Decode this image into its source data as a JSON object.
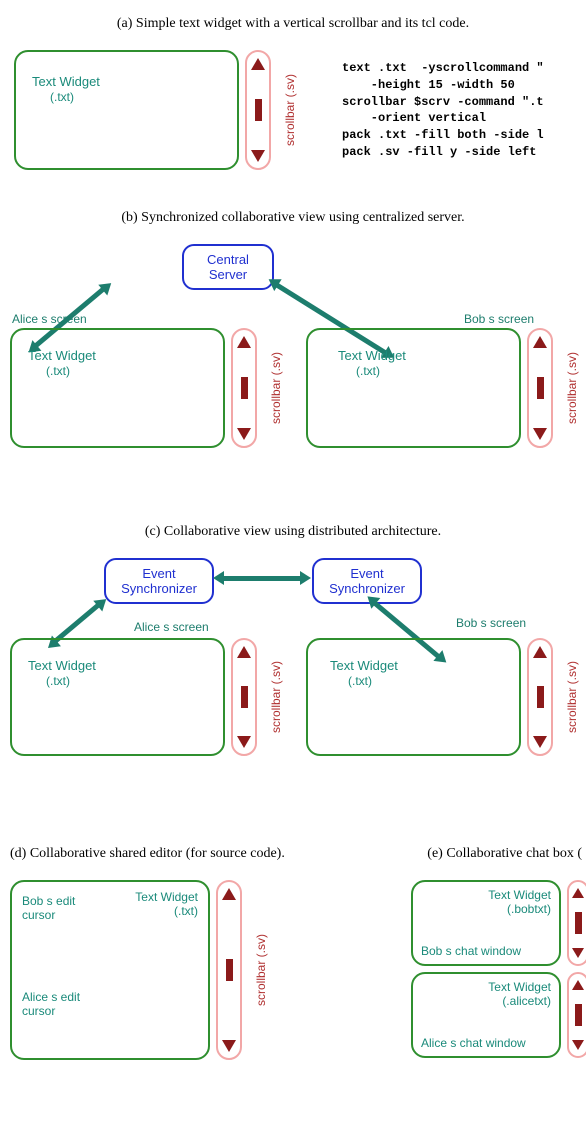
{
  "a": {
    "caption": "(a) Simple text widget with a vertical scrollbar and its tcl code.",
    "widget_label": "Text Widget",
    "widget_sub": "(.txt)",
    "scrollbar_label": "scrollbar (.sv)",
    "code": "text .txt  -yscrollcommand \"\n    -height 15 -width 50\nscrollbar $scrv -command \".t\n    -orient vertical\npack .txt -fill both -side l\npack .sv -fill y -side left"
  },
  "b": {
    "caption": "(b) Synchronized collaborative view using centralized server.",
    "server": "Central\nServer",
    "alice_label": "Alice s screen",
    "bob_label": "Bob s screen",
    "widget_label": "Text Widget",
    "widget_sub": "(.txt)",
    "scrollbar_label": "scrollbar (.sv)"
  },
  "c": {
    "caption": "(c) Collaborative view using distributed architecture.",
    "sync": "Event\nSynchronizer",
    "alice_label": "Alice s screen",
    "bob_label": "Bob s screen",
    "widget_label": "Text Widget",
    "widget_sub": "(.txt)",
    "scrollbar_label": "scrollbar (.sv)"
  },
  "d": {
    "caption": "(d) Collaborative shared editor (for source code).",
    "widget_label": "Text Widget",
    "widget_sub": "(.txt)",
    "bob_cursor": "Bob s edit\ncursor",
    "alice_cursor": "Alice s edit\ncursor",
    "scrollbar_label": "scrollbar (.sv)"
  },
  "e": {
    "caption": "(e) Collaborative chat box (",
    "top_widget_label": "Text Widget",
    "top_widget_sub": "(.bobtxt)",
    "top_window": "Bob s chat window",
    "bot_widget_label": "Text Widget",
    "bot_widget_sub": "(.alicetxt)",
    "bot_window": "Alice s chat window"
  }
}
